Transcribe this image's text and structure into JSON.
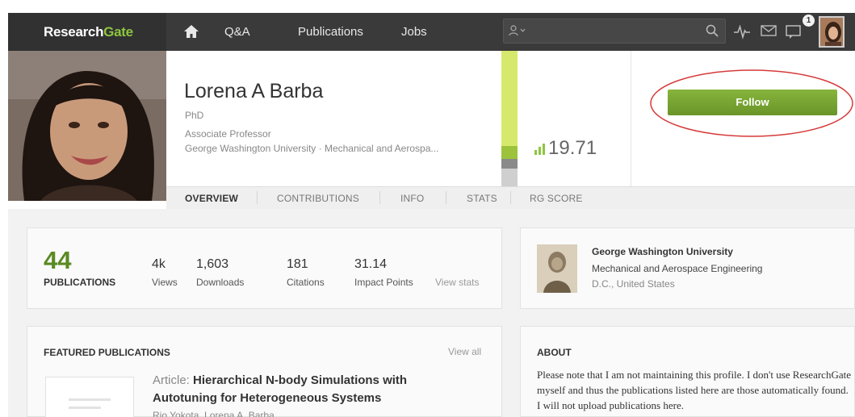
{
  "brand": {
    "name_part1": "Research",
    "name_part2": "Gate",
    "accent": "#8dc63f"
  },
  "nav": {
    "home_icon": "home-icon",
    "links": [
      "Q&A",
      "Publications",
      "Jobs"
    ],
    "search_placeholder": "",
    "notification_count": "1"
  },
  "profile": {
    "name": "Lorena A Barba",
    "degree": "PhD",
    "position": "Associate Professor",
    "affiliation": "George Washington University · Mechanical and Aerospa...",
    "rg_score": "19.71",
    "follow_label": "Follow"
  },
  "tabs": [
    "OVERVIEW",
    "CONTRIBUTIONS",
    "INFO",
    "STATS",
    "RG SCORE"
  ],
  "stats": {
    "publications_count": "44",
    "publications_label": "PUBLICATIONS",
    "items": [
      {
        "value": "4k",
        "label": "Views"
      },
      {
        "value": "1,603",
        "label": "Downloads"
      },
      {
        "value": "181",
        "label": "Citations"
      },
      {
        "value": "31.14",
        "label": "Impact Points"
      }
    ],
    "view_stats": "View stats"
  },
  "institution": {
    "name": "George Washington University",
    "department": "Mechanical and Aerospace Engineering",
    "location": "D.C., United States"
  },
  "featured": {
    "title": "FEATURED PUBLICATIONS",
    "view_all": "View all",
    "pub_type": "Article:",
    "pub_title_line1": "Hierarchical N-body Simulations with",
    "pub_title_line2": "Autotuning for Heterogeneous Systems",
    "pub_authors": "Rio Yokota, Lorena A. Barba"
  },
  "about": {
    "title": "ABOUT",
    "text": "Please note that I am not maintaining this profile. I don't use ResearchGate myself and thus the publications listed here are those automatically found. I will not upload publications here."
  }
}
